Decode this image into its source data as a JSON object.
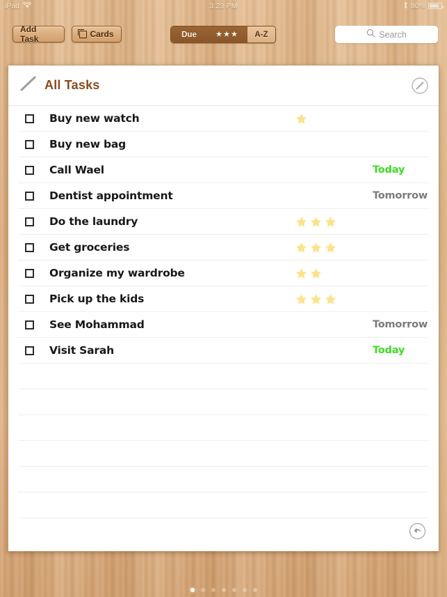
{
  "status_bar": {
    "device": "iPad",
    "wifi_icon": "wifi-icon",
    "time": "3:23 PM",
    "bluetooth_icon": "bluetooth-icon",
    "battery_percent": "80%",
    "battery_level": 80
  },
  "toolbar": {
    "add_task_label": "Add Task",
    "cards_label": "Cards",
    "cards_icon": "cards-icon",
    "segmented": {
      "due_label": "Due",
      "stars_label": "★★★",
      "az_label": "A-Z",
      "selected": "Due"
    },
    "search": {
      "placeholder": "Search",
      "value": "",
      "icon": "search-icon"
    }
  },
  "paper": {
    "title": "All Tasks",
    "title_icon": "pencil-stroke-icon",
    "edit_icon": "edit-pencil-circle-icon",
    "undo_icon": "undo-arrow-icon",
    "accent_color": "#8a4b1e",
    "today_color": "#3ddb22",
    "tomorrow_color": "#7a7a7a",
    "star_color": "#fbe38a"
  },
  "tasks": [
    {
      "label": "Buy new  watch",
      "stars": 1,
      "due": ""
    },
    {
      "label": "Buy new bag",
      "stars": 0,
      "due": ""
    },
    {
      "label": "Call Wael",
      "stars": 0,
      "due": "Today"
    },
    {
      "label": "Dentist appointment",
      "stars": 0,
      "due": "Tomorrow"
    },
    {
      "label": "Do the laundry",
      "stars": 3,
      "due": ""
    },
    {
      "label": "Get groceries",
      "stars": 3,
      "due": ""
    },
    {
      "label": "Organize my wardrobe",
      "stars": 2,
      "due": ""
    },
    {
      "label": "Pick up the kids",
      "stars": 3,
      "due": ""
    },
    {
      "label": "See Mohammad",
      "stars": 0,
      "due": "Tomorrow"
    },
    {
      "label": "Visit Sarah",
      "stars": 0,
      "due": "Today"
    }
  ],
  "empty_rows": 6,
  "page_dots": {
    "count": 7,
    "active_index": 0
  }
}
